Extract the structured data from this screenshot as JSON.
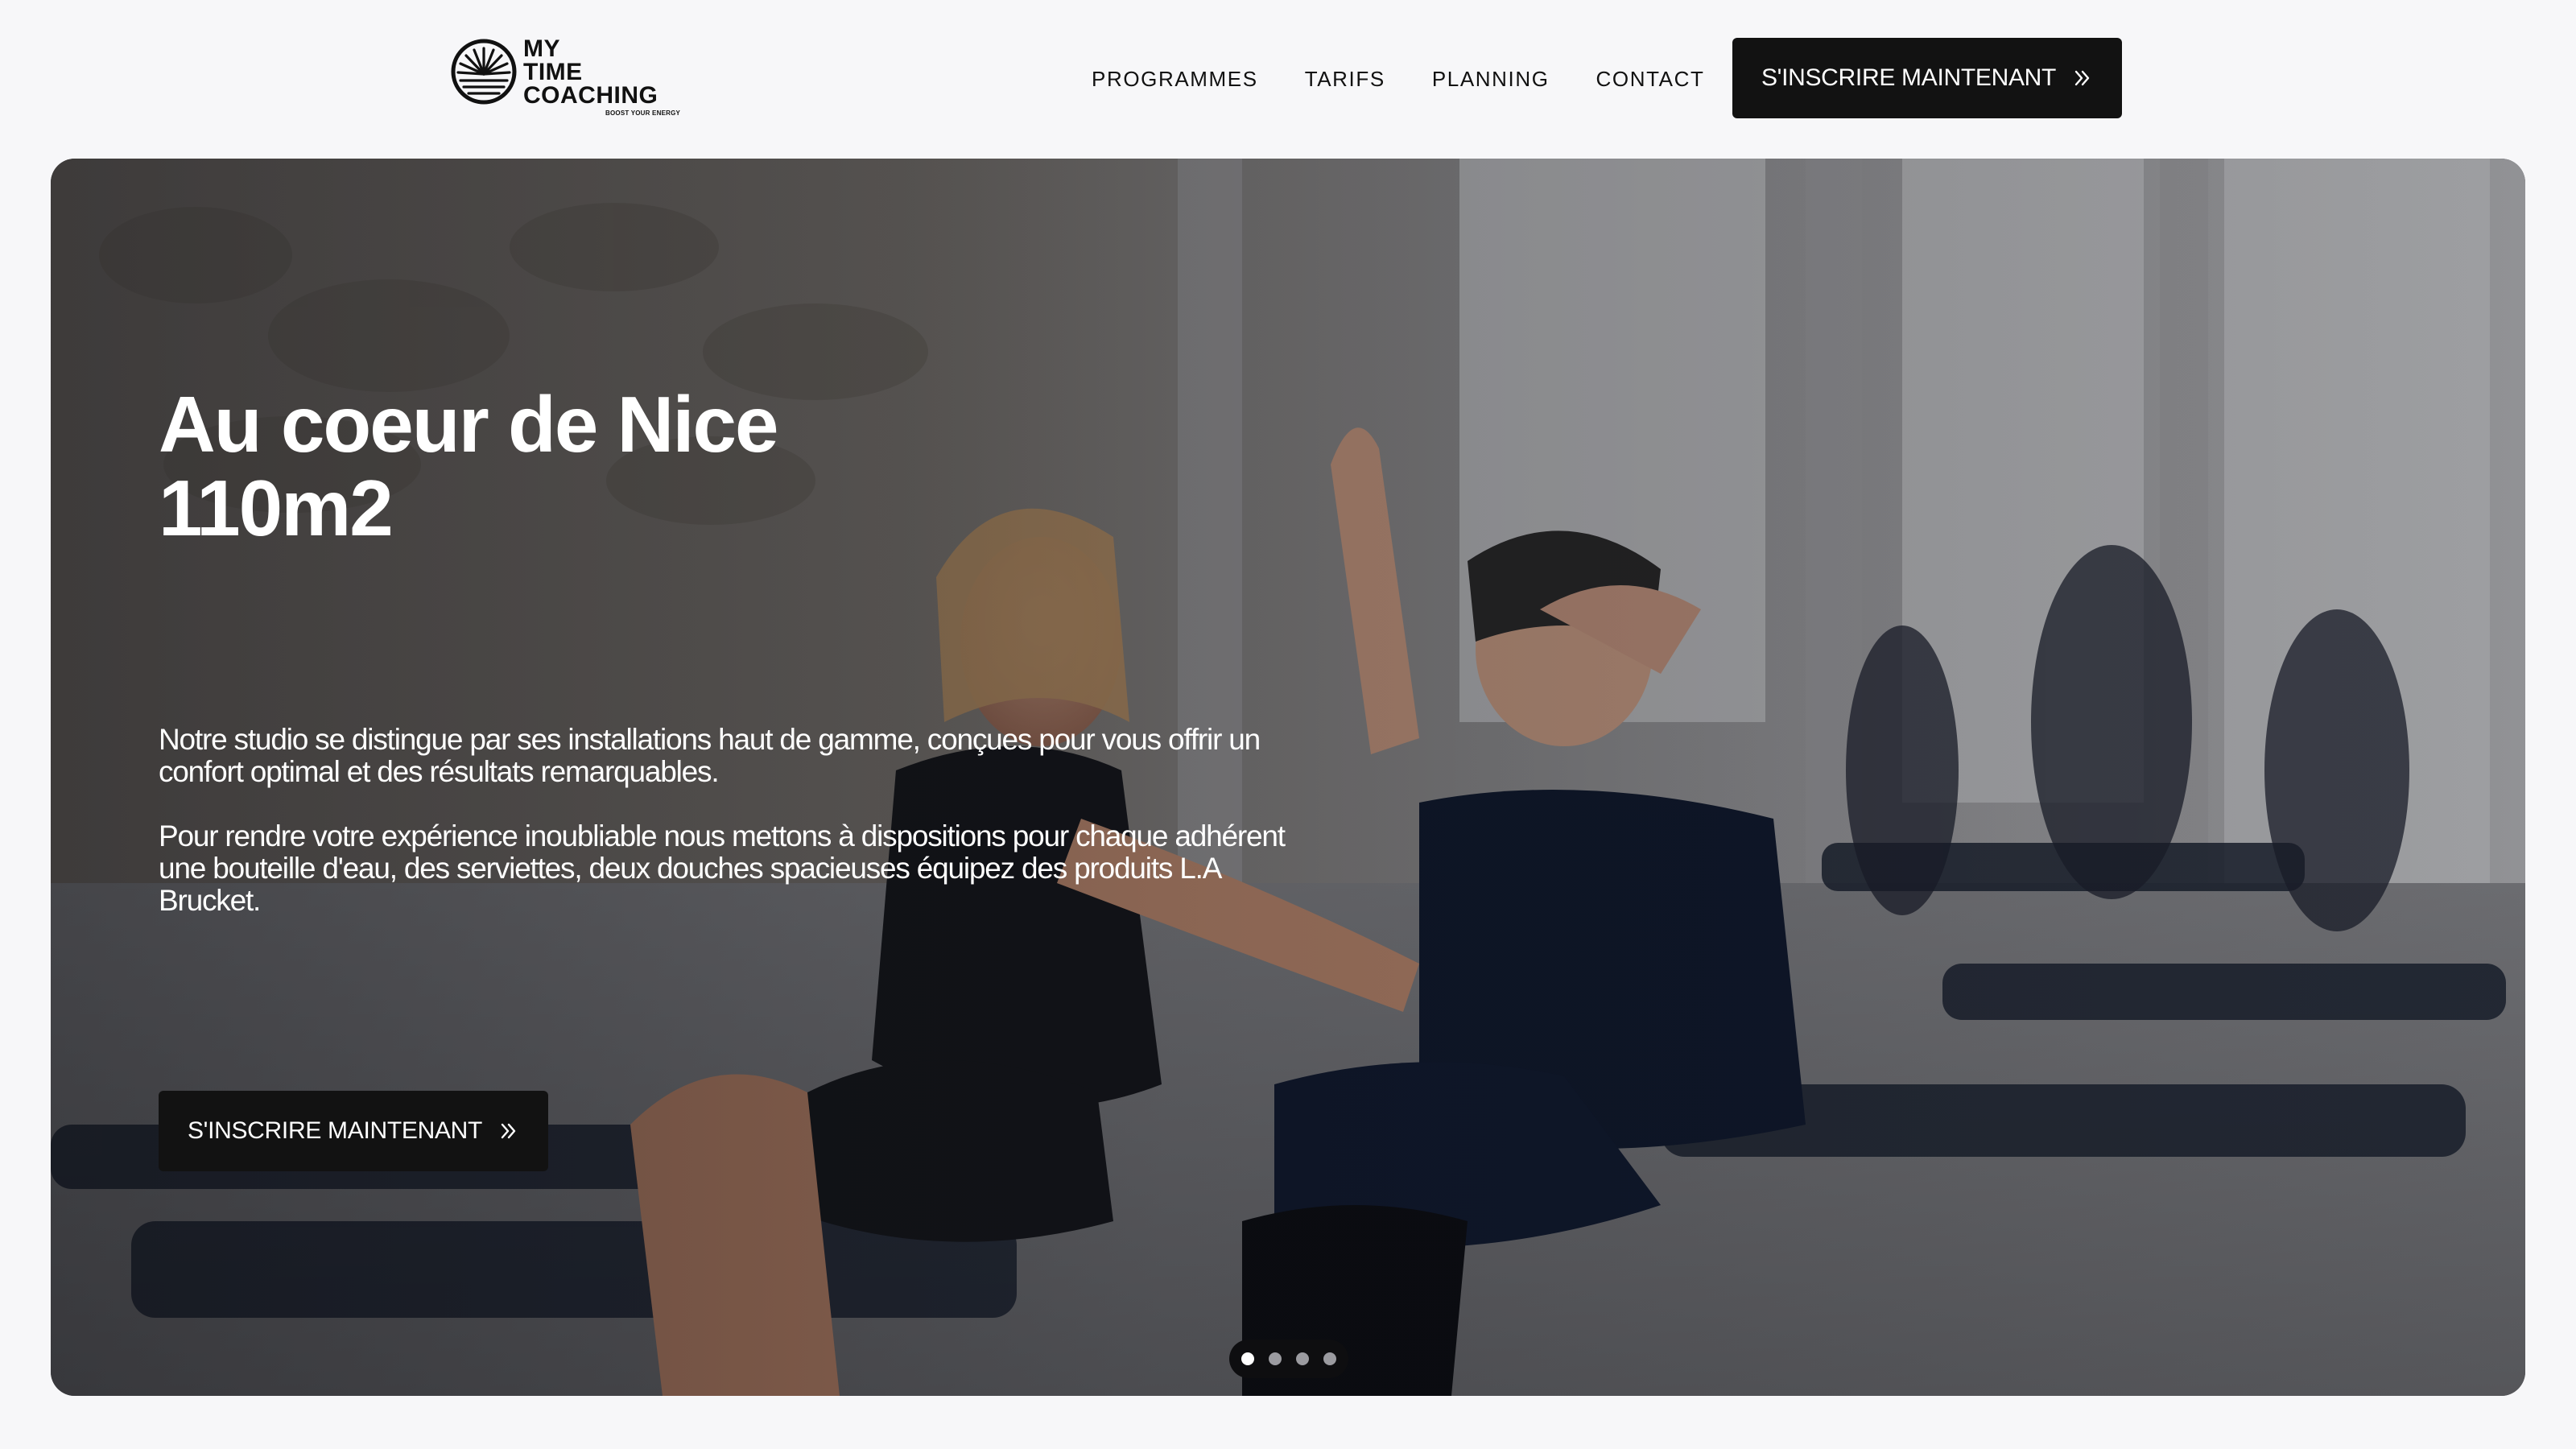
{
  "brand": {
    "logo_lines": [
      "MY",
      "TIME",
      "COACHING"
    ],
    "tagline": "BOOST YOUR ENERGY",
    "icon": "sun-rays-logo-icon"
  },
  "nav": {
    "items": [
      {
        "label": "PROGRAMMES"
      },
      {
        "label": "TARIFS"
      },
      {
        "label": "PLANNING"
      },
      {
        "label": "CONTACT"
      }
    ],
    "cta_label": "S'INSCRIRE MAINTENANT",
    "cta_icon": "double-chevron-right-icon"
  },
  "hero": {
    "title_line1": "Au coeur de Nice",
    "title_line2": "110m2",
    "paragraph1": "Notre studio se distingue par ses installations haut de gamme, conçues pour vous offrir un confort optimal et des résultats remarquables.",
    "paragraph2": "Pour rendre votre expérience inoubliable nous mettons à dispositions pour chaque adhérent une bouteille d'eau, des serviettes, deux douches spacieuses équipez des produits L.A Brucket.",
    "cta_label": "S'INSCRIRE MAINTENANT",
    "cta_icon": "double-chevron-right-icon",
    "slides_total": 4,
    "active_slide": 1
  },
  "colors": {
    "page_bg": "#f7f7f9",
    "button_bg": "#121212",
    "button_text": "#ffffff",
    "text_dark": "#111111"
  }
}
